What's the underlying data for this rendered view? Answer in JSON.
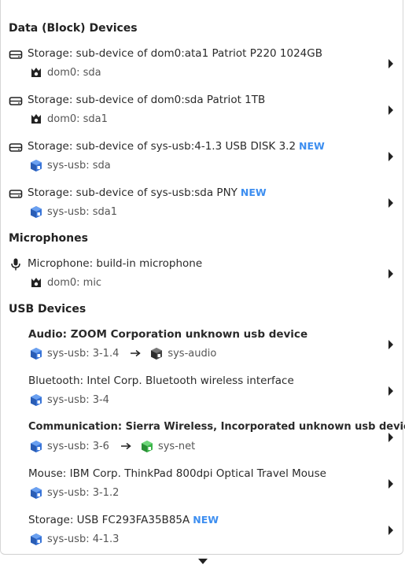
{
  "sections": {
    "block": {
      "title": "Data (Block) Devices",
      "items": [
        {
          "title": "Storage: sub-device of dom0:ata1 Patriot P220 1024GB",
          "badge": "",
          "sub": "dom0: sda"
        },
        {
          "title": "Storage: sub-device of dom0:sda Patriot 1TB",
          "badge": "",
          "sub": "dom0: sda1"
        },
        {
          "title": "Storage: sub-device of sys-usb:4-1.3 USB DISK 3.2",
          "badge": "NEW",
          "sub": "sys-usb: sda"
        },
        {
          "title": "Storage: sub-device of sys-usb:sda PNY",
          "badge": "NEW",
          "sub": "sys-usb: sda1"
        }
      ]
    },
    "mic": {
      "title": "Microphones",
      "items": [
        {
          "title": "Microphone: build-in microphone",
          "sub": "dom0: mic"
        }
      ]
    },
    "usb": {
      "title": "USB Devices",
      "items": [
        {
          "title": "Audio: ZOOM Corporation unknown usb device",
          "sub": "sys-usb: 3-1.4",
          "attached": "sys-audio"
        },
        {
          "title": "Bluetooth: Intel Corp. Bluetooth wireless interface",
          "sub": "sys-usb: 3-4"
        },
        {
          "title": "Communication: Sierra Wireless, Incorporated unknown usb device",
          "sub": "sys-usb: 3-6",
          "attached": "sys-net"
        },
        {
          "title": "Mouse: IBM Corp. ThinkPad 800dpi Optical Travel Mouse",
          "sub": "sys-usb: 3-1.2"
        },
        {
          "title": "Storage: USB FC293FA35B85A",
          "badge": "NEW",
          "sub": "sys-usb: 4-1.3"
        }
      ]
    }
  },
  "colors": {
    "new_badge": "#3d8ef0",
    "sys_usb_qube": "#3874d8",
    "sys_audio_qube": "#444444",
    "sys_net_qube": "#3cb54a",
    "dom0_icon": "#222222"
  },
  "icons": {
    "block": "hard-drive-icon",
    "mic": "microphone-icon",
    "dom0": "dom0-crown-icon",
    "qube": "qube-cube-icon",
    "expand": "chevron-right-icon",
    "scroll": "scroll-down-arrow-icon"
  }
}
